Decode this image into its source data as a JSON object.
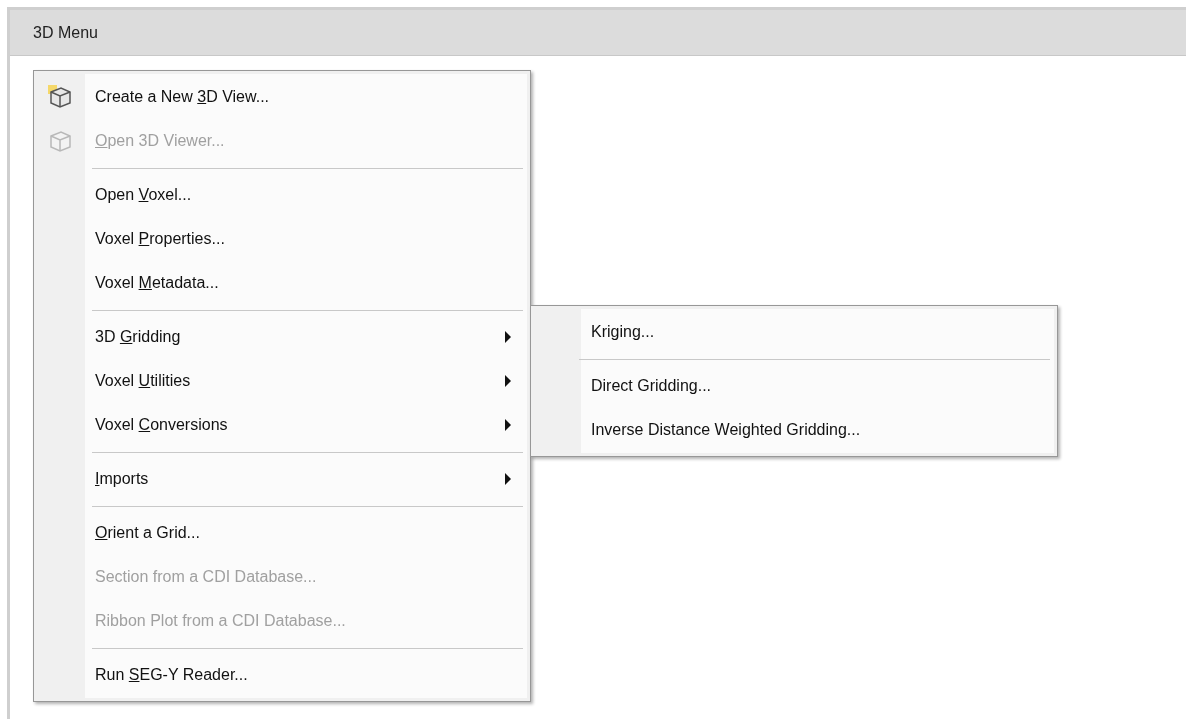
{
  "panel": {
    "title": "3D Menu"
  },
  "menu": {
    "items": [
      {
        "kind": "item",
        "has_icon": true,
        "disabled": false,
        "has_submenu": false,
        "label": [
          {
            "text": "Create a New "
          },
          {
            "text": "3",
            "underlined": true
          },
          {
            "text": "D View..."
          }
        ]
      },
      {
        "kind": "item",
        "has_icon": true,
        "disabled": true,
        "has_submenu": false,
        "label": [
          {
            "text": "O",
            "underlined": true
          },
          {
            "text": "pen 3D Viewer..."
          }
        ]
      },
      {
        "kind": "separator"
      },
      {
        "kind": "item",
        "has_icon": false,
        "disabled": false,
        "has_submenu": false,
        "label": [
          {
            "text": "Open "
          },
          {
            "text": "V",
            "underlined": true
          },
          {
            "text": "oxel..."
          }
        ]
      },
      {
        "kind": "item",
        "has_icon": false,
        "disabled": false,
        "has_submenu": false,
        "label": [
          {
            "text": "Voxel "
          },
          {
            "text": "P",
            "underlined": true
          },
          {
            "text": "roperties..."
          }
        ]
      },
      {
        "kind": "item",
        "has_icon": false,
        "disabled": false,
        "has_submenu": false,
        "label": [
          {
            "text": "Voxel "
          },
          {
            "text": "M",
            "underlined": true
          },
          {
            "text": "etadata..."
          }
        ]
      },
      {
        "kind": "separator"
      },
      {
        "kind": "item",
        "has_icon": false,
        "disabled": false,
        "has_submenu": true,
        "label": [
          {
            "text": "3D "
          },
          {
            "text": "G",
            "underlined": true
          },
          {
            "text": "ridding"
          }
        ],
        "submenu": [
          {
            "kind": "item",
            "label": [
              {
                "text": "Kriging..."
              }
            ]
          },
          {
            "kind": "separator"
          },
          {
            "kind": "item",
            "label": [
              {
                "text": "Direct Gridding..."
              }
            ]
          },
          {
            "kind": "item",
            "label": [
              {
                "text": "Inverse Distance Weighted Gridding..."
              }
            ]
          }
        ]
      },
      {
        "kind": "item",
        "has_icon": false,
        "disabled": false,
        "has_submenu": true,
        "label": [
          {
            "text": "Voxel "
          },
          {
            "text": "U",
            "underlined": true
          },
          {
            "text": "tilities"
          }
        ]
      },
      {
        "kind": "item",
        "has_icon": false,
        "disabled": false,
        "has_submenu": true,
        "label": [
          {
            "text": "Voxel "
          },
          {
            "text": "C",
            "underlined": true
          },
          {
            "text": "onversions"
          }
        ]
      },
      {
        "kind": "separator"
      },
      {
        "kind": "item",
        "has_icon": false,
        "disabled": false,
        "has_submenu": true,
        "label": [
          {
            "text": "I",
            "underlined": true
          },
          {
            "text": "mports"
          }
        ]
      },
      {
        "kind": "separator"
      },
      {
        "kind": "item",
        "has_icon": false,
        "disabled": false,
        "has_submenu": false,
        "label": [
          {
            "text": "O",
            "underlined": true
          },
          {
            "text": "rient a Grid..."
          }
        ]
      },
      {
        "kind": "item",
        "has_icon": false,
        "disabled": true,
        "has_submenu": false,
        "label": [
          {
            "text": "Section from a CDI Database..."
          }
        ]
      },
      {
        "kind": "item",
        "has_icon": false,
        "disabled": true,
        "has_submenu": false,
        "label": [
          {
            "text": "Ribbon Plot from a CDI Database..."
          }
        ]
      },
      {
        "kind": "separator"
      },
      {
        "kind": "item",
        "has_icon": false,
        "disabled": false,
        "has_submenu": false,
        "label": [
          {
            "text": "Run "
          },
          {
            "text": "S",
            "underlined": true
          },
          {
            "text": "EG-Y Reader..."
          }
        ]
      }
    ]
  }
}
